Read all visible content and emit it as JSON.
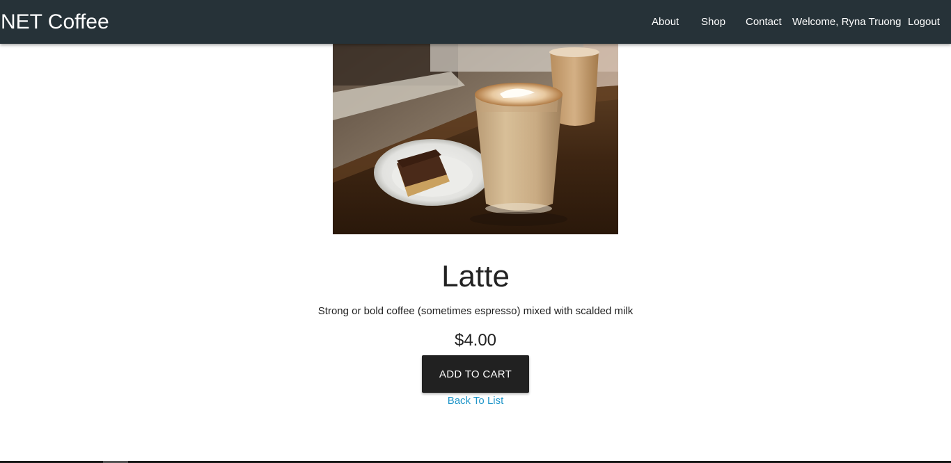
{
  "navbar": {
    "brand": "NET Coffee",
    "links": {
      "about": "About",
      "shop": "Shop",
      "contact": "Contact",
      "welcome": "Welcome, Ryna Truong",
      "logout": "Logout"
    },
    "background_color": "#263238"
  },
  "product": {
    "image_alt": "Latte with chocolate slice",
    "name": "Latte",
    "description": "Strong or bold coffee (sometimes espresso) mixed with scalded milk",
    "price": "$4.00",
    "add_to_cart_label": "ADD TO CART",
    "back_link_label": "Back To List"
  },
  "colors": {
    "button": "#212121",
    "link": "#2196c9"
  }
}
